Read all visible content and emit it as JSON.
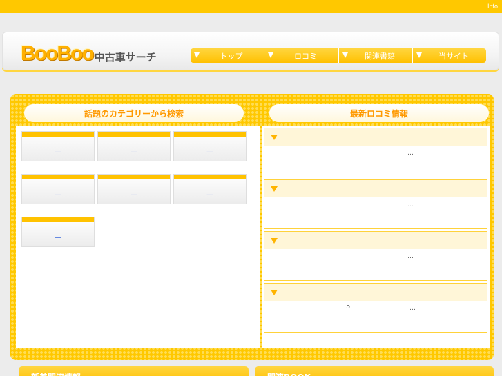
{
  "topbar": {
    "info_label": "Info"
  },
  "header": {
    "logo_boo": "BooBoo",
    "logo_jp": "中古車サーチ"
  },
  "nav": {
    "items": [
      {
        "label": "トップ"
      },
      {
        "label": "ロコミ"
      },
      {
        "label": "関連書籍"
      },
      {
        "label": "当サイト"
      }
    ]
  },
  "sections": {
    "category_title": "話題のカテゴリーから検索",
    "reviews_title": "最新ロコミ情報"
  },
  "categories": [
    {
      "link": "—"
    },
    {
      "link": "—"
    },
    {
      "link": "—"
    },
    {
      "link": "—"
    },
    {
      "link": "—"
    },
    {
      "link": "—"
    },
    {
      "link": "—"
    }
  ],
  "reviews": [
    {
      "text": "…"
    },
    {
      "text": "…"
    },
    {
      "text": "…"
    },
    {
      "number": "5",
      "text": "…"
    }
  ],
  "bottom": {
    "left_title": "新着関連情報",
    "right_title": "関連BOOK"
  },
  "colors": {
    "accent": "#ffc800",
    "accent_text": "#ff9900",
    "link": "#1a4fd6"
  }
}
